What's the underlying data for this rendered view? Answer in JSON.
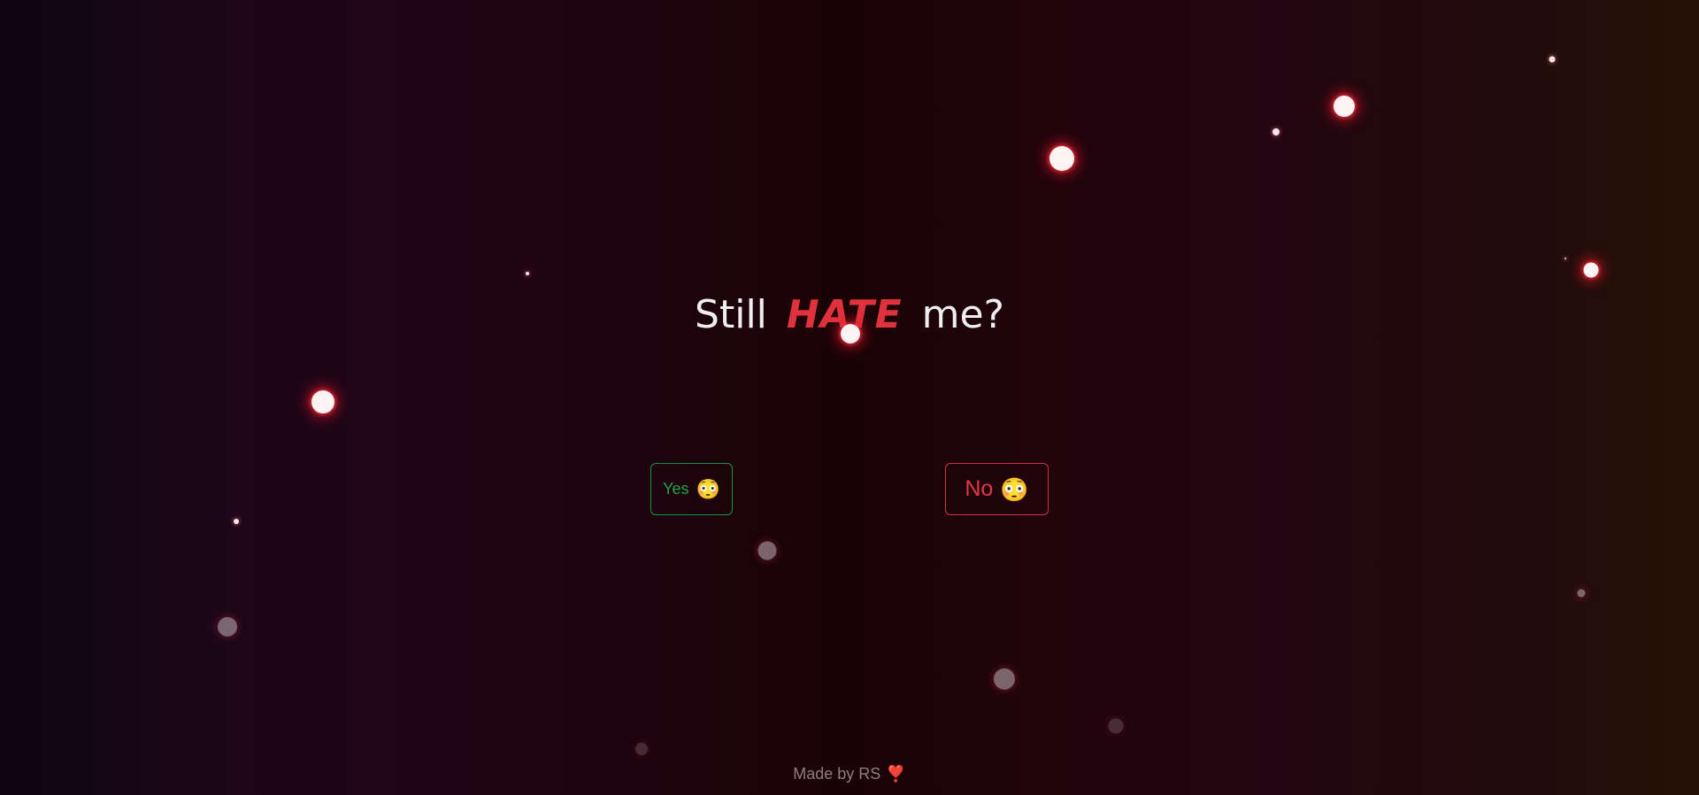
{
  "question": {
    "before": "Still",
    "emphasis": "HATE",
    "after": "me?"
  },
  "buttons": {
    "yes": {
      "label": "Yes",
      "emoji": "😳"
    },
    "no": {
      "label": "No",
      "emoji": "😳"
    }
  },
  "footer": {
    "text": "Made by RS",
    "icon": "❣️"
  },
  "colors": {
    "yes_accent": "#26a152",
    "no_accent": "#e23846",
    "emphasis": "#e0323d"
  }
}
